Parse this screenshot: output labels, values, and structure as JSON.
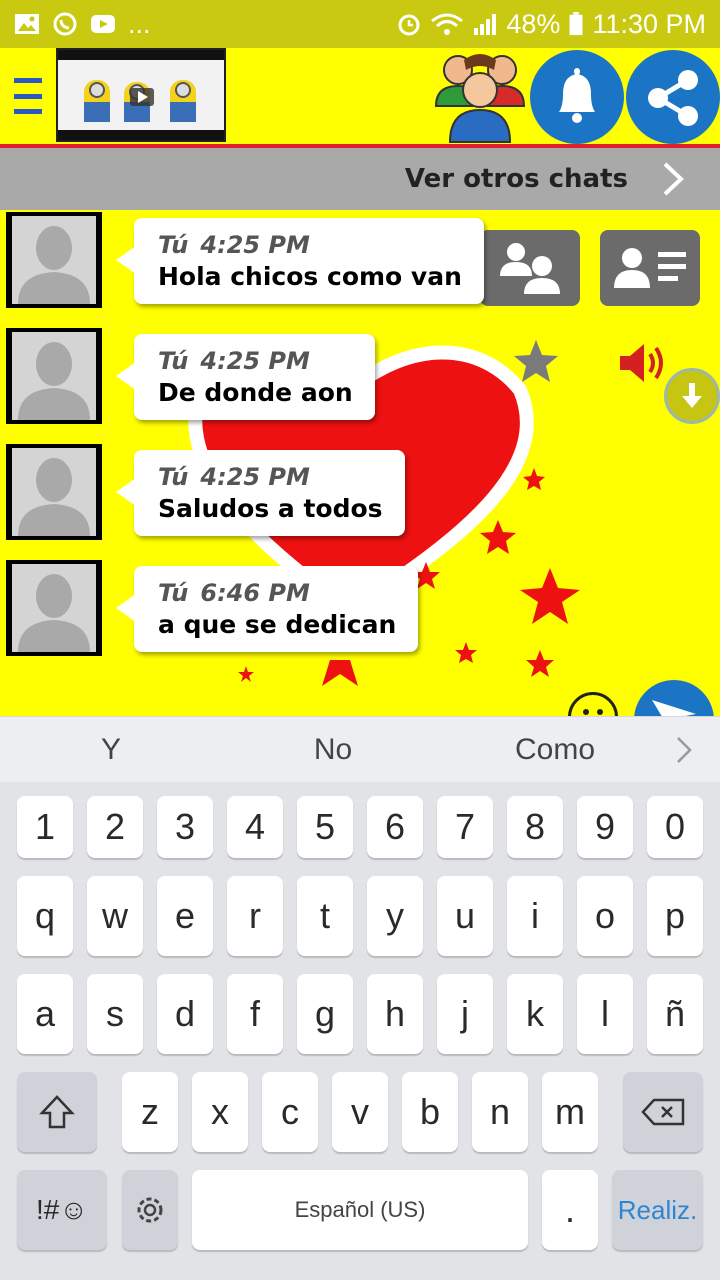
{
  "status_bar": {
    "left_icons": [
      "gallery-icon",
      "whatsapp-icon",
      "youtube-icon"
    ],
    "more": "...",
    "battery": "48%",
    "time": "11:30 PM"
  },
  "header": {
    "menu_icon": "hamburger-menu-icon",
    "banner_icon": "video-banner",
    "users_icon": "users-icon",
    "bell_icon": "bell-icon",
    "share_icon": "share-icon"
  },
  "other_chats": {
    "label": "Ver otros chats"
  },
  "messages": [
    {
      "sender": "Tú",
      "time": "4:25 PM",
      "text": "Hola chicos como van"
    },
    {
      "sender": "Tú",
      "time": "4:25 PM",
      "text": "De donde aon"
    },
    {
      "sender": "Tú",
      "time": "4:25 PM",
      "text": "Saludos a todos"
    },
    {
      "sender": "Tú",
      "time": "6:46 PM",
      "text": "a que se dedican"
    }
  ],
  "suggestions": [
    "Y",
    "No",
    "Como"
  ],
  "keyboard": {
    "numbers": [
      "1",
      "2",
      "3",
      "4",
      "5",
      "6",
      "7",
      "8",
      "9",
      "0"
    ],
    "row1": [
      "q",
      "w",
      "e",
      "r",
      "t",
      "y",
      "u",
      "i",
      "o",
      "p"
    ],
    "row2": [
      "a",
      "s",
      "d",
      "f",
      "g",
      "h",
      "j",
      "k",
      "l",
      "ñ"
    ],
    "row3": [
      "z",
      "x",
      "c",
      "v",
      "b",
      "n",
      "m"
    ],
    "symbols": "!#☺",
    "space": "Español (US)",
    "period": ".",
    "done": "Realiz."
  },
  "colors": {
    "header_bg": "#ffff00",
    "status_bg": "#c9c912",
    "accent_blue": "#1b74c4",
    "heart_red": "#ee1111"
  }
}
